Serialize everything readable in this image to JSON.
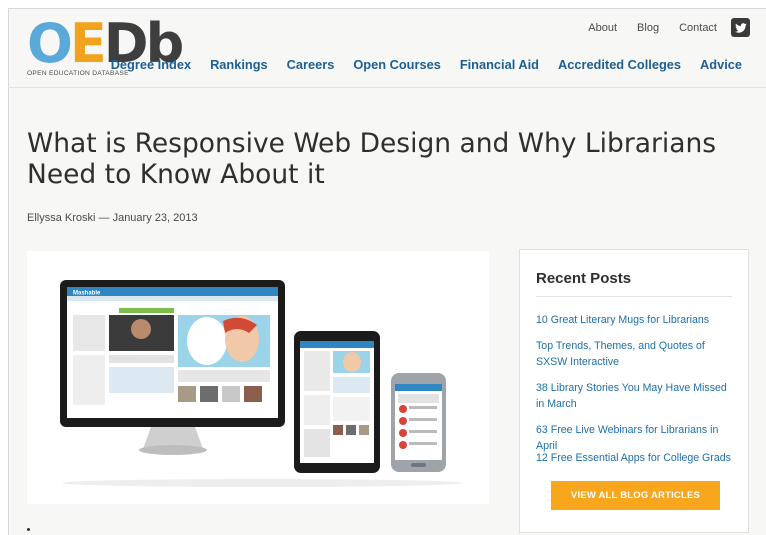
{
  "logo": {
    "letters": [
      "O",
      "E",
      "Db"
    ],
    "tagline": "OPEN EDUCATION DATABASE"
  },
  "top_nav": [
    {
      "label": "About"
    },
    {
      "label": "Blog"
    },
    {
      "label": "Contact"
    }
  ],
  "twitter_icon": "twitter-icon",
  "main_nav": [
    {
      "label": "Degree Index"
    },
    {
      "label": "Rankings"
    },
    {
      "label": "Careers"
    },
    {
      "label": "Open Courses"
    },
    {
      "label": "Financial Aid"
    },
    {
      "label": "Accredited Colleges"
    },
    {
      "label": "Advice"
    }
  ],
  "article": {
    "title": "What is Responsive Web Design and Why Librarians Need to Know About it",
    "byline": "Ellyssa Kroski — January 23, 2013",
    "image_label": "Mashable"
  },
  "sidebar": {
    "heading": "Recent Posts",
    "posts": [
      "10 Great Literary Mugs for Librarians",
      "Top Trends, Themes, and Quotes of SXSW Interactive",
      "38 Library Stories You May Have Missed in March",
      "63 Free Live Webinars for Librarians in April",
      "12 Free Essential Apps for College Grads"
    ],
    "button": "VIEW ALL BLOG ARTICLES"
  },
  "colors": {
    "nav": "#1d5f93",
    "link": "#1d6fa8",
    "button": "#f7a61d",
    "logo_o": "#5aa9d8",
    "logo_e": "#f2a21c",
    "logo_db": "#3e3e3e"
  }
}
